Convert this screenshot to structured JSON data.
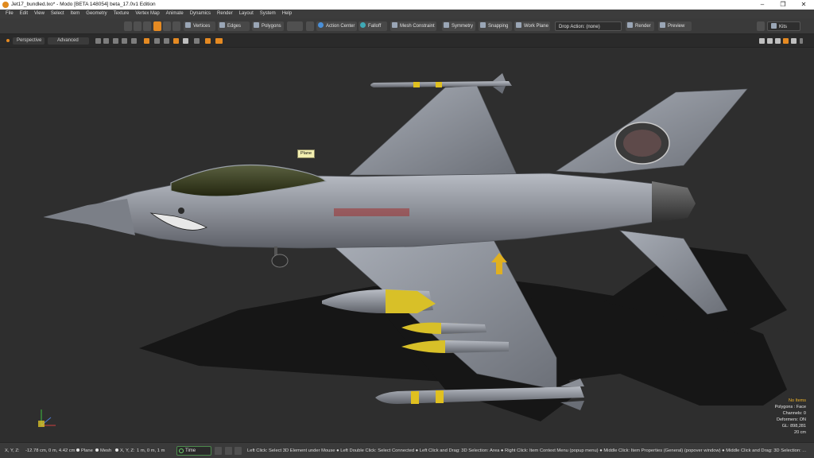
{
  "window": {
    "title": "Jet17_bundled.lxo* - Modo [BETA 148054]   beta_17.0v1 Edition",
    "minimize_icon": "minimize-icon",
    "maximize_icon": "restore-icon",
    "close_icon": "close-icon"
  },
  "menu": [
    "File",
    "Edit",
    "View",
    "Select",
    "Item",
    "Geometry",
    "Texture",
    "Vertex Map",
    "Animate",
    "Dynamics",
    "Render",
    "Layout",
    "System",
    "Help"
  ],
  "toolbar": {
    "vertices": "Vertices",
    "edges": "Edges",
    "polygons": "Polygons",
    "action_center": "Action Center",
    "falloff": "Falloff",
    "mesh_constraint": "Mesh Constraint",
    "symmetry": "Symmetry",
    "snapping": "Snapping",
    "work_plane": "Work Plane",
    "drop_action": "Drop Action: (none)",
    "render": "Render",
    "preview": "Preview",
    "kits": "Kits"
  },
  "viewport": {
    "view_mode": "Perspective",
    "shading": "Advanced",
    "tooltip": "Plane"
  },
  "stats": {
    "title": "No Items",
    "polygons": "Polygons : Face",
    "channels": "Channels: 0",
    "deformers": "Deformers: ON",
    "gl": "GL: 898,281",
    "scale": "20 cm"
  },
  "statusbar": {
    "coords_label": "X, Y, Z:",
    "coords_value": "-12.78 cm, 0 m, 4.42 cm",
    "plane": "Plane",
    "mesh": "Mesh",
    "coords2_label": "X, Y, Z:",
    "coords2_value": "1 m, 0 m, 1 m",
    "time": "Time",
    "hints": "Left Click: Select 3D Element under Mouse ● Left Double Click: Select Connected ● Left Click and Drag: 3D Selection: Area ● Right Click: Item Context Menu (popup menu) ● Middle Click: Item Properties (General) (popover window) ● Middle Click and Drag: 3D Selection: ..."
  },
  "colors": {
    "accent": "#e58a22",
    "background": "#2e2e2e",
    "tooltip": "#f2eeb0",
    "stats_title": "#f0b429",
    "missile_yellow": "#e0c020"
  }
}
